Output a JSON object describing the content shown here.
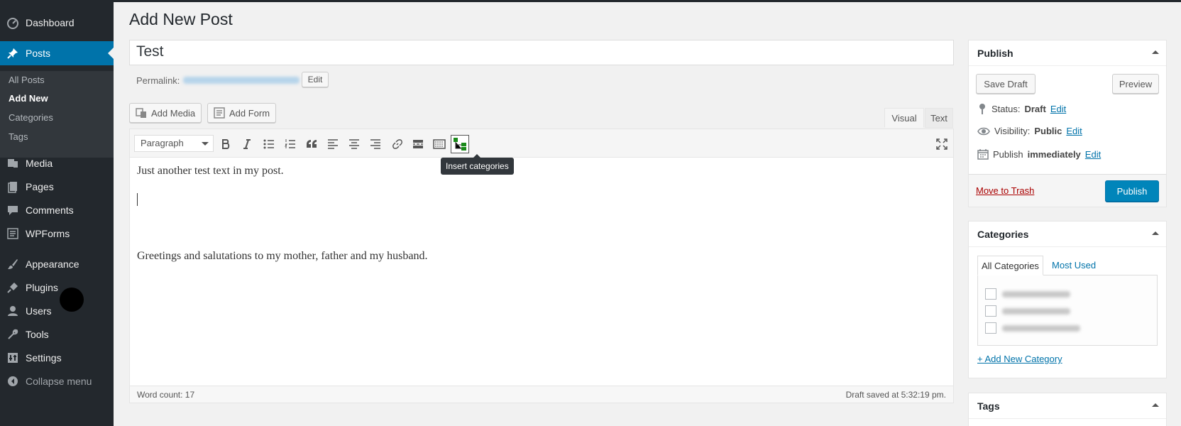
{
  "sidebar": {
    "items": [
      {
        "label": "Dashboard",
        "icon": "dashboard-icon"
      },
      {
        "label": "Posts",
        "icon": "pushpin-icon"
      },
      {
        "label": "Media",
        "icon": "media-icon"
      },
      {
        "label": "Pages",
        "icon": "pages-icon"
      },
      {
        "label": "Comments",
        "icon": "comment-icon"
      },
      {
        "label": "WPForms",
        "icon": "form-icon"
      },
      {
        "label": "Appearance",
        "icon": "paintbrush-icon"
      },
      {
        "label": "Plugins",
        "icon": "plugin-icon"
      },
      {
        "label": "Users",
        "icon": "user-icon"
      },
      {
        "label": "Tools",
        "icon": "wrench-icon"
      },
      {
        "label": "Settings",
        "icon": "settings-icon"
      }
    ],
    "submenu": [
      "All Posts",
      "Add New",
      "Categories",
      "Tags"
    ],
    "collapse_label": "Collapse menu"
  },
  "page": {
    "title": "Add New Post",
    "post_title": "Test",
    "permalink_label": "Permalink:",
    "permalink_edit": "Edit"
  },
  "media_buttons": {
    "add_media": "Add Media",
    "add_form": "Add Form"
  },
  "editor": {
    "tab_visual": "Visual",
    "tab_text": "Text",
    "format_value": "Paragraph",
    "tooltip": "Insert categories",
    "paragraph1": "Just another test text in my post.",
    "paragraph2": "Greetings and salutations to my mother, father and my husband.",
    "word_count": "Word count: 17",
    "draft_saved": "Draft saved at 5:32:19 pm."
  },
  "publish_box": {
    "title": "Publish",
    "save_draft": "Save Draft",
    "preview": "Preview",
    "status_label": "Status:",
    "status_value": "Draft",
    "visibility_label": "Visibility:",
    "visibility_value": "Public",
    "publish_label": "Publish",
    "publish_value": "immediately",
    "edit": "Edit",
    "move_to_trash": "Move to Trash",
    "publish_button": "Publish"
  },
  "categories_box": {
    "title": "Categories",
    "tab_all": "All Categories",
    "tab_most_used": "Most Used",
    "add_new": "+ Add New Category"
  },
  "tags_box": {
    "title": "Tags"
  },
  "colors": {
    "sidebar_bg": "#23282d",
    "active_menu": "#0073aa",
    "publish_button": "#0085ba",
    "link": "#0073aa",
    "trash": "#a00"
  }
}
